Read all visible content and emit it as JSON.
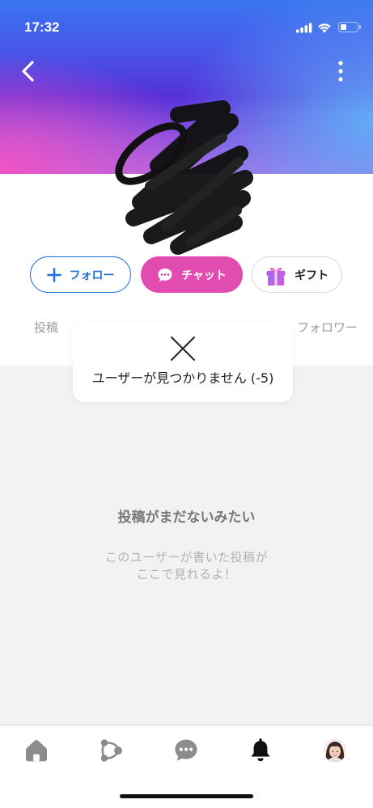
{
  "status_bar": {
    "time": "17:32",
    "signal_icon": "cellular-signal-icon",
    "wifi_icon": "wifi-icon",
    "battery_icon": "battery-icon",
    "battery_level": 0.4
  },
  "nav": {
    "back_icon": "chevron-left-icon",
    "more_icon": "more-vertical-icon"
  },
  "actions": {
    "follow": {
      "icon": "plus-icon",
      "label": "フォロー"
    },
    "chat": {
      "icon": "chat-bubble-icon",
      "label": "チャット"
    },
    "gift": {
      "icon": "gift-icon",
      "label": "ギフト"
    }
  },
  "stats": {
    "posts_label": "投稿",
    "followers_label": "フォロワー"
  },
  "toast": {
    "icon": "close-icon",
    "message": "ユーザーが見つかりません (-5)"
  },
  "empty_state": {
    "title": "投稿がまだないみたい",
    "subtitle_lines": [
      "このユーザーが書いた投稿が",
      "ここで見れるよ！"
    ]
  },
  "tab_bar": {
    "items": [
      {
        "icon": "home-icon",
        "active": false
      },
      {
        "icon": "share-nodes-icon",
        "active": false
      },
      {
        "icon": "chat-bubble-icon",
        "active": false
      },
      {
        "icon": "bell-icon",
        "active": true
      },
      {
        "icon": "profile-avatar-icon",
        "active": false
      }
    ]
  },
  "colors": {
    "follow_blue": "#1f6fd8",
    "chat_pink": "#e24cb1",
    "background_grey": "#f2f2f2",
    "tab_active": "#111111",
    "tab_inactive": "#8c8c8c"
  }
}
